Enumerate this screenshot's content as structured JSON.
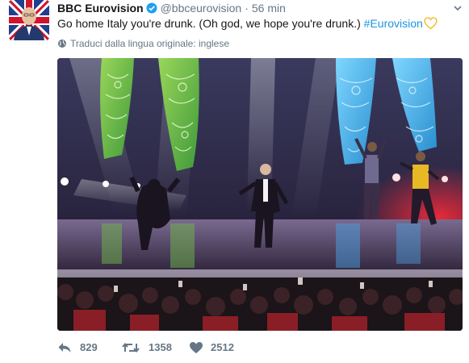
{
  "tweet": {
    "display_name": "BBC Eurovision",
    "handle": "@bbceurovision",
    "separator": "·",
    "time": "56 min",
    "text": "Go home Italy you're drunk. (Oh god, we hope you're drunk.) ",
    "hashtag": "#Eurovision",
    "translate_label": "Traduci dalla lingua originale: inglese",
    "counts": {
      "replies": "829",
      "retweets": "1358",
      "likes": "2512"
    }
  },
  "icons": {
    "verified": "verified-badge-icon",
    "chevron": "chevron-down-icon",
    "heart_emoji": "yellow-heart-emoji",
    "globe": "globe-icon",
    "reply": "reply-icon",
    "retweet": "retweet-icon",
    "like": "heart-icon"
  },
  "colors": {
    "link": "#1b95e0",
    "muted": "#657786",
    "text": "#14171a",
    "verified": "#1da1f2"
  }
}
